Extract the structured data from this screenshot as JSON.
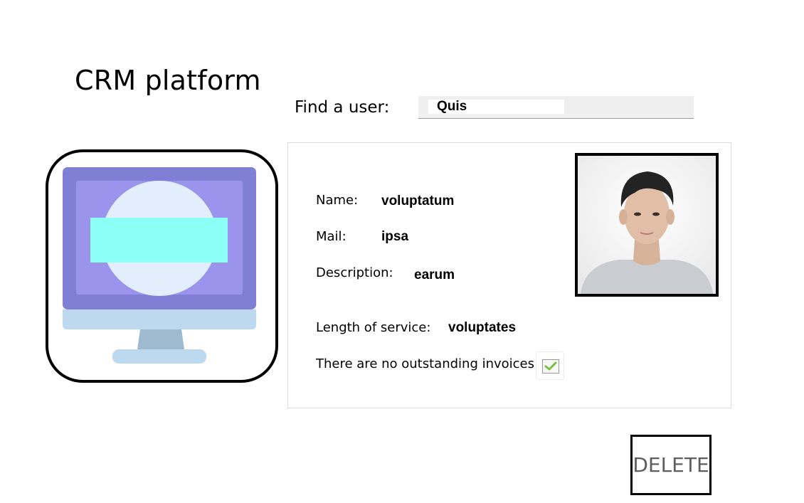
{
  "app": {
    "title": "CRM platform"
  },
  "search": {
    "label": "Find a user:",
    "value": "Quis"
  },
  "profile": {
    "fields": {
      "name": {
        "label": "Name:",
        "value": "voluptatum"
      },
      "mail": {
        "label": "Mail:",
        "value": "ipsa"
      },
      "description": {
        "label": "Description:",
        "value": "earum"
      },
      "length_of_service": {
        "label": "Length of service:",
        "value": "voluptates"
      }
    },
    "invoices": {
      "label": "There are no outstanding invoices",
      "checked": true
    },
    "photo_icon": "user-photo"
  },
  "device_icon": "desktop-monitor-icon",
  "actions": {
    "delete_label": "DELETE"
  },
  "colors": {
    "monitor_frame": "#7f7fd5",
    "monitor_screen": "#9b94ec",
    "monitor_circle": "#e2eefb",
    "monitor_bar": "#8cfff7",
    "monitor_stand": "#9fb9cf",
    "monitor_base": "#bcd9ef",
    "check_mark": "#76c043"
  }
}
